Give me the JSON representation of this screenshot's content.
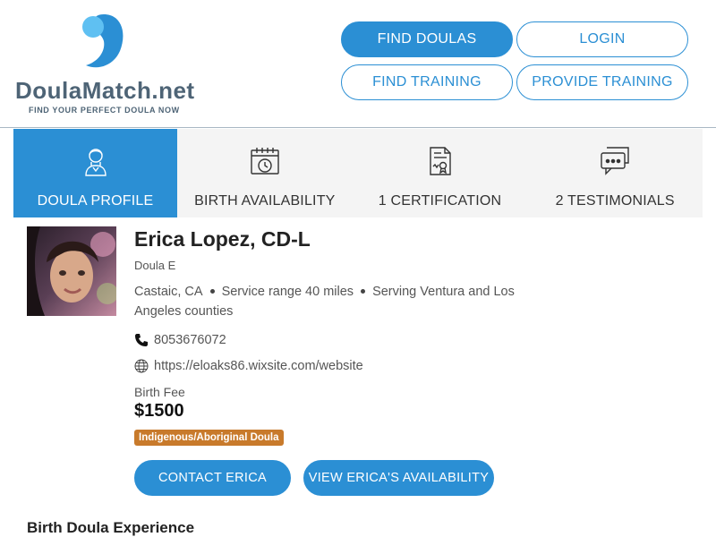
{
  "brand": {
    "logo_name": "DoulaMatch.net",
    "tagline": "FIND YOUR PERFECT DOULA NOW",
    "primary_color": "#2b8fd4",
    "text_color": "#4e6476"
  },
  "nav": {
    "find_doulas": "FIND DOULAS",
    "login": "LOGIN",
    "find_training": "FIND TRAINING",
    "provide_training": "PROVIDE TRAINING"
  },
  "tabs": [
    {
      "label": "DOULA PROFILE",
      "icon": "person-icon",
      "active": true
    },
    {
      "label": "BIRTH AVAILABILITY",
      "icon": "calendar-clock-icon",
      "active": false
    },
    {
      "label": "1 CERTIFICATION",
      "icon": "certificate-icon",
      "active": false
    },
    {
      "label": "2 TESTIMONIALS",
      "icon": "chat-bubbles-icon",
      "active": false
    }
  ],
  "profile": {
    "name": "Erica Lopez, CD-L",
    "subtitle": "Doula E",
    "city": "Castaic, CA",
    "service_range": "Service range 40 miles",
    "serving": "Serving Ventura and Los Angeles counties",
    "phone": "8053676072",
    "website": "https://eloaks86.wixsite.com/website",
    "fee_label": "Birth Fee",
    "fee_value": "$1500",
    "badge": "Indigenous/Aboriginal Doula",
    "badge_color": "#c87a2b"
  },
  "actions": {
    "contact": "CONTACT ERICA",
    "availability": "VIEW ERICA'S AVAILABILITY"
  },
  "sections": {
    "experience_title": "Birth Doula Experience"
  }
}
